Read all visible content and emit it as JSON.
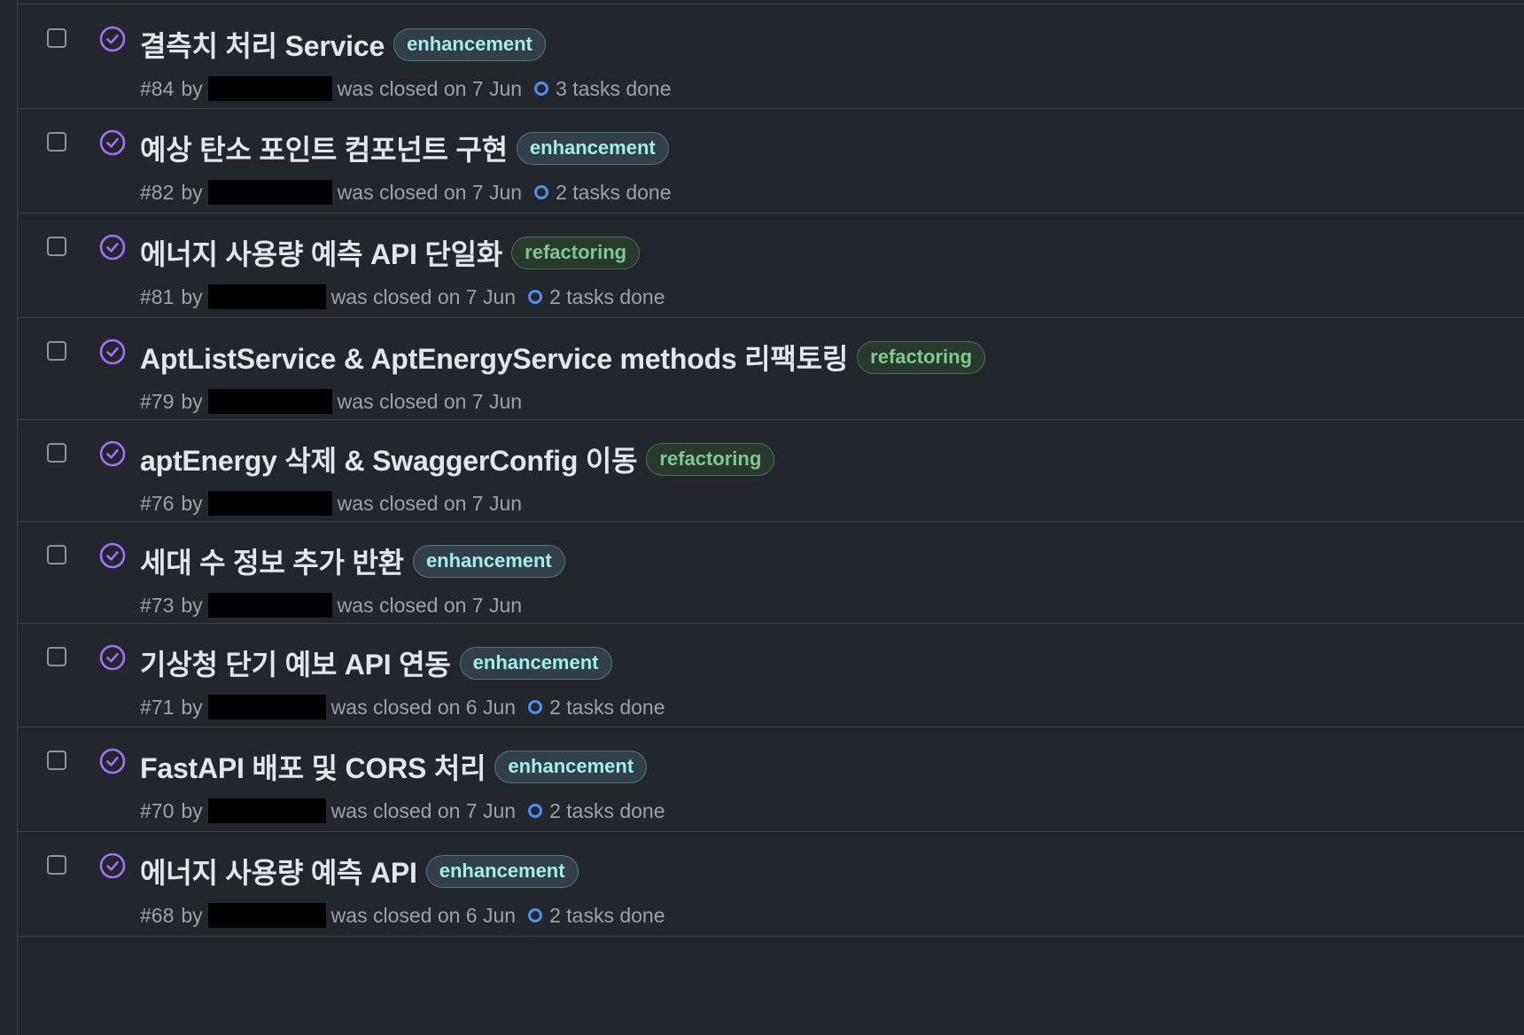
{
  "colors": {
    "background": "#22262d",
    "border": "#3b424c",
    "closed_icon": "#a371f7",
    "title": "#e1e6ec",
    "meta": "#9aa2ac",
    "task_ring": "#4f8ff0"
  },
  "issues": [
    {
      "title": "결측치 처리 Service",
      "label": "enhancement",
      "number": "#84",
      "by": "by",
      "closed_text": "was closed on 7 Jun",
      "tasks": "3 tasks done"
    },
    {
      "title": "예상 탄소 포인트 컴포넌트 구현",
      "label": "enhancement",
      "number": "#82",
      "by": "by",
      "closed_text": "was closed on 7 Jun",
      "tasks": "2 tasks done"
    },
    {
      "title": "에너지 사용량 예측 API 단일화",
      "label": "refactoring",
      "number": "#81",
      "by": "by",
      "closed_text": "was closed on 7 Jun",
      "tasks": "2 tasks done"
    },
    {
      "title": "AptListService & AptEnergyService methods 리팩토링",
      "label": "refactoring",
      "number": "#79",
      "by": "by",
      "closed_text": "was closed on 7 Jun",
      "tasks": ""
    },
    {
      "title": "aptEnergy 삭제 & SwaggerConfig 이동",
      "label": "refactoring",
      "number": "#76",
      "by": "by",
      "closed_text": "was closed on 7 Jun",
      "tasks": ""
    },
    {
      "title": "세대 수 정보 추가 반환",
      "label": "enhancement",
      "number": "#73",
      "by": "by",
      "closed_text": "was closed on 7 Jun",
      "tasks": ""
    },
    {
      "title": "기상청 단기 예보 API 연동",
      "label": "enhancement",
      "number": "#71",
      "by": "by",
      "closed_text": "was closed on 6 Jun",
      "tasks": "2 tasks done"
    },
    {
      "title": "FastAPI 배포 및 CORS 처리",
      "label": "enhancement",
      "number": "#70",
      "by": "by",
      "closed_text": "was closed on 7 Jun",
      "tasks": "2 tasks done"
    },
    {
      "title": "에너지 사용량 예측 API",
      "label": "enhancement",
      "number": "#68",
      "by": "by",
      "closed_text": "was closed on 6 Jun",
      "tasks": "2 tasks done"
    }
  ]
}
